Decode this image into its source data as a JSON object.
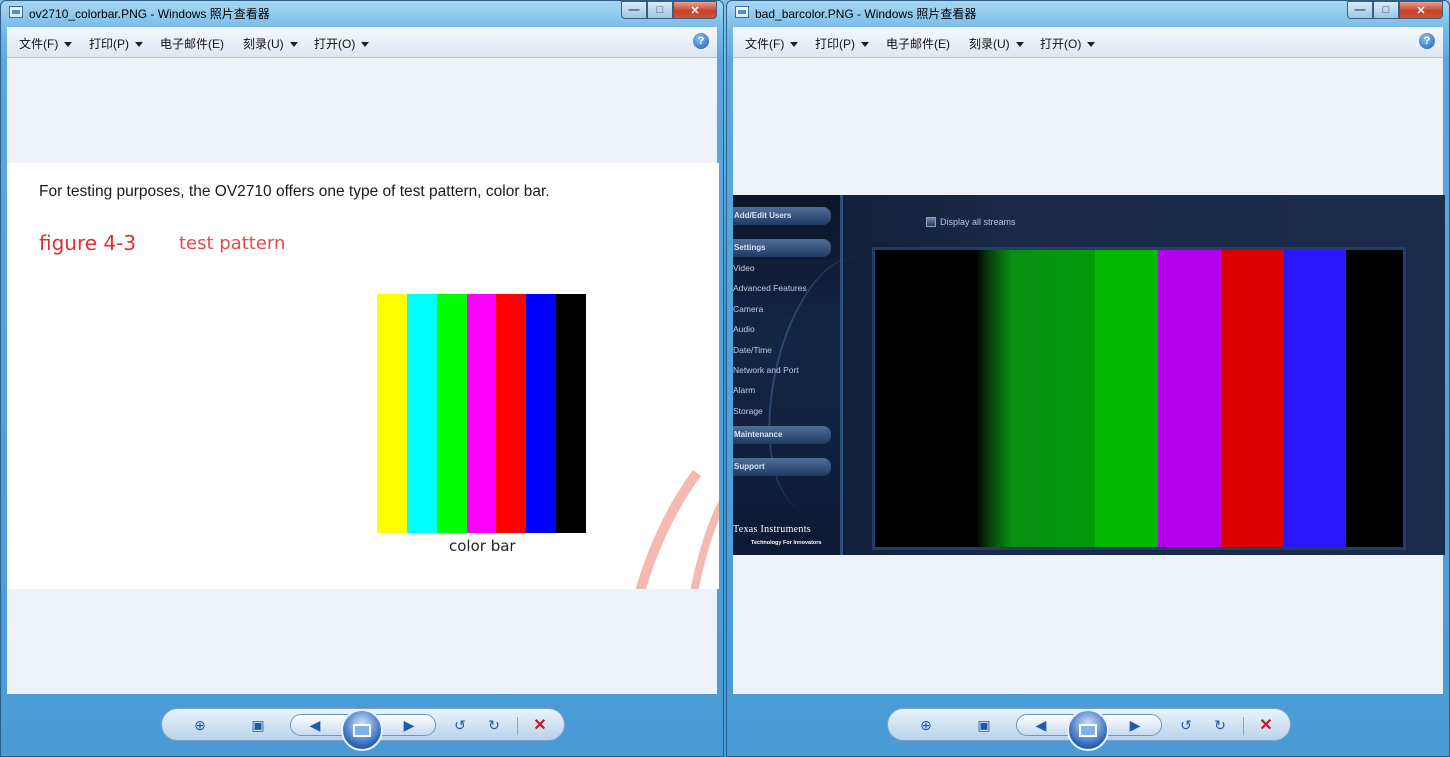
{
  "left_window": {
    "title": "ov2710_colorbar.PNG - Windows 照片查看器",
    "menu": [
      {
        "label": "文件(F)",
        "has_caret": true
      },
      {
        "label": "打印(P)",
        "has_caret": true
      },
      {
        "label": "电子邮件(E)",
        "has_caret": false
      },
      {
        "label": "刻录(U)",
        "has_caret": true
      },
      {
        "label": "打开(O)",
        "has_caret": true
      }
    ],
    "help_glyph": "?",
    "document": {
      "body_text": "For testing purposes, the OV2710 offers one type of test pattern, color bar.",
      "figure_label": "figure 4-3",
      "figure_title": "test pattern",
      "bar_colors": [
        "#ffff00",
        "#00ffff",
        "#00ff00",
        "#ff00ff",
        "#ff0000",
        "#0000ff",
        "#000000"
      ],
      "bar_caption": "color bar"
    }
  },
  "right_window": {
    "title": "bad_barcolor.PNG - Windows 照片查看器",
    "menu": [
      {
        "label": "文件(F)",
        "has_caret": true
      },
      {
        "label": "打印(P)",
        "has_caret": true
      },
      {
        "label": "电子邮件(E)",
        "has_caret": false
      },
      {
        "label": "刻录(U)",
        "has_caret": true
      },
      {
        "label": "打开(O)",
        "has_caret": true
      }
    ],
    "help_glyph": "?",
    "dvr_ui": {
      "sections": [
        {
          "label": "Add/Edit Users"
        },
        {
          "label": "Settings"
        },
        {
          "label": "Maintenance"
        },
        {
          "label": "Support"
        }
      ],
      "settings_links": [
        "Video",
        "Advanced Features",
        "Camera",
        "Audio",
        "Date/Time",
        "Network and Port",
        "Alarm",
        "Storage"
      ],
      "checkbox_label": "Display all streams",
      "logo_text": "Texas Instruments",
      "logo_tagline": "Technology For Innovators",
      "video_bars": [
        {
          "color": "#000000",
          "weight": 1.6
        },
        {
          "color": "#009a0a",
          "weight": 1.9
        },
        {
          "color": "#00b800",
          "weight": 1.0
        },
        {
          "color": "#b500f0",
          "weight": 1.0
        },
        {
          "color": "#dd0000",
          "weight": 1.0
        },
        {
          "color": "#2a16ff",
          "weight": 1.0
        },
        {
          "color": "#000000",
          "weight": 0.9
        }
      ]
    }
  },
  "viewer_controls": {
    "zoom": "zoom-icon",
    "actual_size": "fit-icon",
    "prev": "previous-icon",
    "slideshow": "slideshow-icon",
    "next": "next-icon",
    "rotate_ccw": "rotate-left-icon",
    "rotate_cw": "rotate-right-icon",
    "delete": "delete-icon"
  }
}
